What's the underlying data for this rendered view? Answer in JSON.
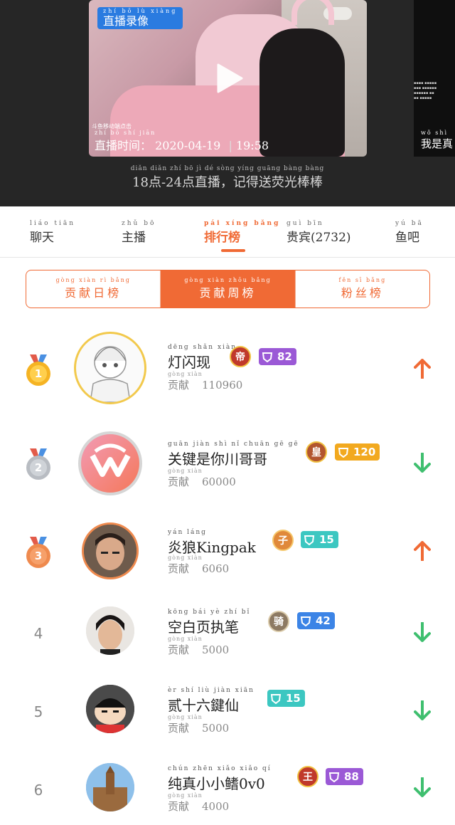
{
  "video": {
    "tag_pinyin": "zhí bō lù xiàng",
    "tag": "直播录像",
    "time_pinyin": "zhí bō shí jiān",
    "time_label": "直播时间：",
    "date": "2020-04-19",
    "clock": "19:58",
    "logo_text": "斗鱼移动端点击",
    "caption_pinyin": "diǎn diǎn zhí bō jì dé sòng yíng guāng bàng bàng",
    "caption": "18点-24点直播，记得送荧光棒棒"
  },
  "side_thumb": {
    "caption_pinyin": "wǒ shì",
    "caption": "我是真"
  },
  "tabs": [
    {
      "pinyin": "liáo tiān",
      "label": "聊天"
    },
    {
      "pinyin": "zhǔ bō",
      "label": "主播"
    },
    {
      "pinyin": "pái xíng bǎng",
      "label": "排行榜"
    },
    {
      "pinyin": "guì bīn",
      "label": "贵宾(2732)"
    },
    {
      "pinyin": "yú bā",
      "label": "鱼吧"
    }
  ],
  "active_tab": "排行榜",
  "segments": [
    {
      "pinyin": "gòng xiàn rì bǎng",
      "label": "贡献日榜"
    },
    {
      "pinyin": "gòng xiàn zhōu bǎng",
      "label": "贡献周榜"
    },
    {
      "pinyin": "fěn sī bǎng",
      "label": "粉丝榜"
    }
  ],
  "active_segment": "贡献周榜",
  "contribution_label": "贡献",
  "contribution_pinyin": "gòng xiàn",
  "ranking": [
    {
      "rank": "1",
      "name": "灯闪现",
      "name_pinyin": "dēng shǎn xiàn",
      "contribution": "110960",
      "noble": "帝",
      "noble_color": "#c0392b",
      "fan_level": "82",
      "fan_color": "#9b59d6",
      "trend": "up"
    },
    {
      "rank": "2",
      "name": "关键是你川哥哥",
      "name_pinyin": "guān jiàn shì nǐ chuān gē gē",
      "contribution": "60000",
      "noble": "皇",
      "noble_color": "#b2552f",
      "fan_level": "120",
      "fan_color": "#f2a91f",
      "trend": "down"
    },
    {
      "rank": "3",
      "name": "炎狼Kingpak",
      "name_pinyin": "yán láng",
      "contribution": "6060",
      "noble": "子",
      "noble_color": "#e0893a",
      "fan_level": "15",
      "fan_color": "#3cc7c1",
      "trend": "up"
    },
    {
      "rank": "4",
      "name": "空白页执笔",
      "name_pinyin": "kōng bái yè zhí bǐ",
      "contribution": "5000",
      "noble": "骑",
      "noble_color": "#8d7a63",
      "fan_level": "42",
      "fan_color": "#3c84e6",
      "trend": "down"
    },
    {
      "rank": "5",
      "name": "贰十六鍵仙",
      "name_pinyin": "èr shí liù jiàn xiān",
      "contribution": "5000",
      "noble": "",
      "noble_color": "",
      "fan_level": "15",
      "fan_color": "#3cc7c1",
      "trend": "down"
    },
    {
      "rank": "6",
      "name": "纯真小小鳍0v0",
      "name_pinyin": "chún zhēn xiǎo xiǎo qí",
      "contribution": "4000",
      "noble": "王",
      "noble_color": "#c0392b",
      "fan_level": "88",
      "fan_color": "#9b59d6",
      "trend": "down"
    }
  ],
  "colors": {
    "accent": "#f06a35",
    "trend_up": "#f06a35",
    "trend_down": "#3fbf6f",
    "gold_medal": "#f5b323",
    "silver_medal": "#b8bcc2",
    "bronze_medal": "#ef8a4e"
  }
}
